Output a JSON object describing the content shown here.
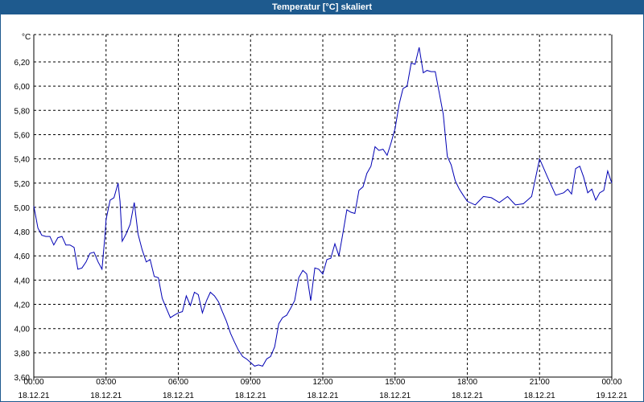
{
  "window": {
    "title": "Temperatur [°C] skaliert"
  },
  "colors": {
    "titlebar": "#1e5a8e",
    "line": "#0000b4",
    "grid": "#000000"
  },
  "chart_data": {
    "type": "line",
    "title": "Temperatur [°C] skaliert",
    "ylabel": "°C",
    "xlabel": "",
    "ylim": [
      3.6,
      6.3
    ],
    "xlim_hours": [
      0,
      24
    ],
    "grid": true,
    "x_ticks": [
      {
        "time": "00:00",
        "date": "18.12.21"
      },
      {
        "time": "03:00",
        "date": "18.12.21"
      },
      {
        "time": "06:00",
        "date": "18.12.21"
      },
      {
        "time": "09:00",
        "date": "18.12.21"
      },
      {
        "time": "12:00",
        "date": "18.12.21"
      },
      {
        "time": "15:00",
        "date": "18.12.21"
      },
      {
        "time": "18:00",
        "date": "18.12.21"
      },
      {
        "time": "21:00",
        "date": "18.12.21"
      },
      {
        "time": "00:00",
        "date": "19.12.21"
      }
    ],
    "y_ticks": [
      "6,20",
      "6,00",
      "5,80",
      "5,60",
      "5,40",
      "5,20",
      "5,00",
      "4,80",
      "4,60",
      "4,40",
      "4,20",
      "4,00",
      "3,80",
      "3,60"
    ],
    "series": [
      {
        "x": [
          0,
          0.17,
          0.33,
          0.5,
          0.67,
          0.83,
          1.0,
          1.17,
          1.33,
          1.5,
          1.67,
          1.83,
          2.0,
          2.17,
          2.33,
          2.5,
          2.67,
          2.83,
          2.95,
          3.0,
          3.17,
          3.33,
          3.5,
          3.58,
          3.67,
          3.83,
          4.0,
          4.17,
          4.33,
          4.5,
          4.67,
          4.83,
          5.0,
          5.17,
          5.33,
          5.5,
          5.67,
          5.83,
          6.0,
          6.17,
          6.33,
          6.5,
          6.67,
          6.83,
          7.0,
          7.17,
          7.33,
          7.5,
          7.67,
          7.83,
          8.0,
          8.17,
          8.33,
          8.5,
          8.67,
          8.83,
          9.0,
          9.17,
          9.33,
          9.5,
          9.67,
          9.83,
          10.0,
          10.17,
          10.33,
          10.5,
          10.67,
          10.83,
          11.0,
          11.17,
          11.33,
          11.5,
          11.67,
          11.83,
          12.0,
          12.17,
          12.33,
          12.5,
          12.67,
          12.83,
          13.0,
          13.17,
          13.33,
          13.5,
          13.67,
          13.83,
          14.0,
          14.17,
          14.33,
          14.5,
          14.67,
          14.83,
          15.0,
          15.17,
          15.33,
          15.5,
          15.67,
          15.83,
          16.0,
          16.17,
          16.33,
          16.5,
          16.67,
          16.83,
          17.0,
          17.17,
          17.33,
          17.5,
          17.67,
          17.83,
          18.0,
          18.33,
          18.67,
          19.0,
          19.33,
          19.67,
          20.0,
          20.33,
          20.67,
          21.0,
          21.33,
          21.67,
          22.0,
          22.17,
          22.33,
          22.5,
          22.67,
          22.83,
          23.0,
          23.17,
          23.33,
          23.5,
          23.67,
          23.83,
          24.0
        ],
        "y": [
          5.01,
          4.83,
          4.77,
          4.76,
          4.76,
          4.69,
          4.75,
          4.76,
          4.69,
          4.69,
          4.67,
          4.49,
          4.5,
          4.55,
          4.62,
          4.63,
          4.55,
          4.49,
          4.76,
          4.9,
          5.06,
          5.08,
          5.2,
          5.05,
          4.72,
          4.78,
          4.86,
          5.04,
          4.78,
          4.65,
          4.55,
          4.57,
          4.43,
          4.42,
          4.25,
          4.17,
          4.09,
          4.11,
          4.13,
          4.14,
          4.27,
          4.19,
          4.3,
          4.28,
          4.13,
          4.23,
          4.3,
          4.27,
          4.22,
          4.14,
          4.06,
          3.96,
          3.89,
          3.82,
          3.77,
          3.75,
          3.72,
          3.69,
          3.7,
          3.69,
          3.75,
          3.77,
          3.85,
          4.04,
          4.09,
          4.11,
          4.17,
          4.23,
          4.42,
          4.48,
          4.45,
          4.23,
          4.5,
          4.49,
          4.45,
          4.57,
          4.58,
          4.7,
          4.6,
          4.78,
          4.98,
          4.96,
          4.95,
          5.14,
          5.17,
          5.28,
          5.34,
          5.5,
          5.47,
          5.48,
          5.43,
          5.53,
          5.65,
          5.85,
          5.98,
          6.0,
          6.19,
          6.18,
          6.32,
          6.11,
          6.13,
          6.12,
          6.12,
          5.95,
          5.77,
          5.42,
          5.35,
          5.22,
          5.15,
          5.1,
          5.05,
          5.02,
          5.09,
          5.08,
          5.04,
          5.09,
          5.02,
          5.03,
          5.09,
          5.4,
          5.25,
          5.1,
          5.12,
          5.15,
          5.11,
          5.32,
          5.34,
          5.25,
          5.12,
          5.15,
          5.06,
          5.12,
          5.14,
          5.3,
          5.2
        ]
      }
    ]
  }
}
